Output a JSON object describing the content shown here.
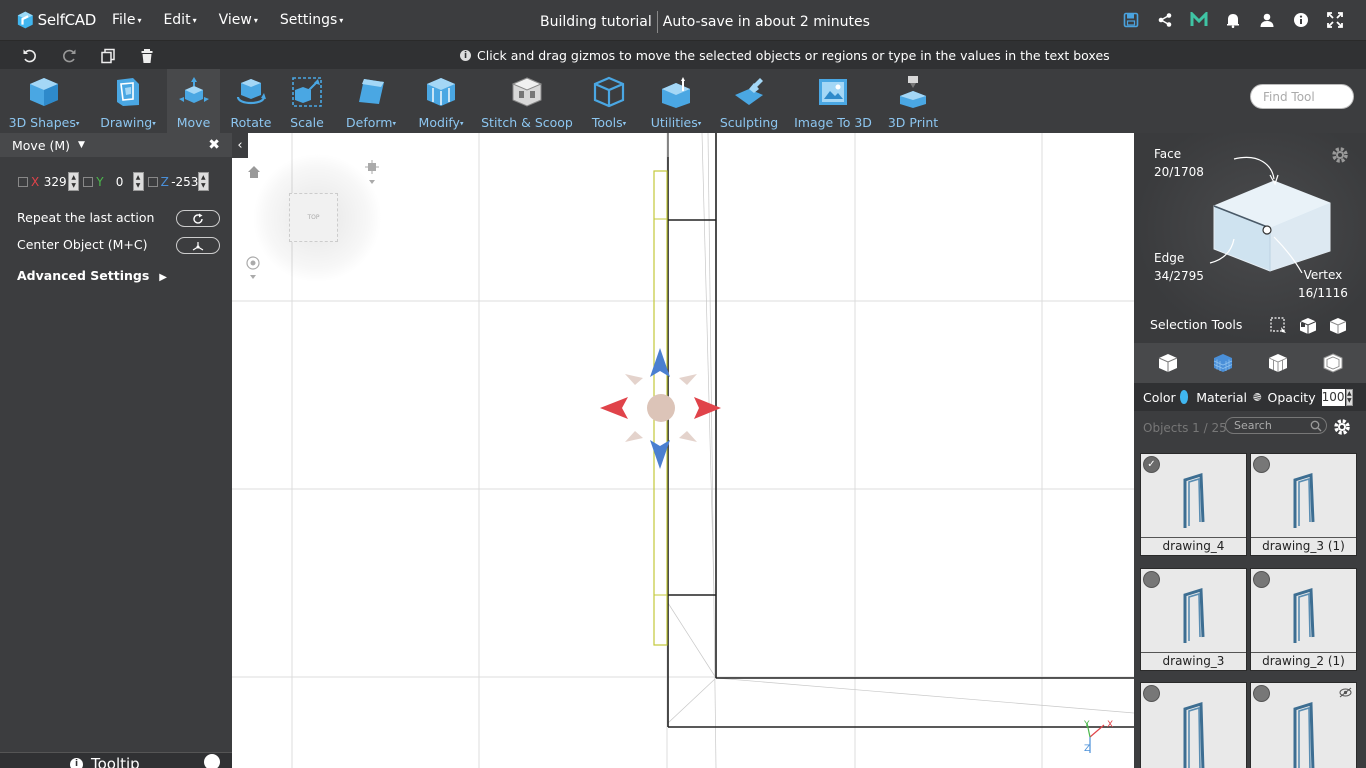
{
  "app": {
    "name": "SelfCAD"
  },
  "menu": [
    {
      "label": "File"
    },
    {
      "label": "Edit"
    },
    {
      "label": "View"
    },
    {
      "label": "Settings"
    }
  ],
  "project": {
    "title": "Building tutorial",
    "autosave": "Auto-save in about 2 minutes"
  },
  "topbar_icons": [
    "save-icon",
    "share-icon",
    "m-icon",
    "bell-icon",
    "user-icon",
    "info-icon",
    "fullscreen-icon"
  ],
  "secondbar": {
    "icons": [
      "undo-icon",
      "redo-icon",
      "copy-icon",
      "delete-icon"
    ],
    "hint": "Click and drag gizmos to move the selected objects or regions or type in the values in the text boxes"
  },
  "toolbar": {
    "tools": [
      {
        "label": "3D Shapes",
        "dropdown": true
      },
      {
        "label": "Drawing",
        "dropdown": true
      },
      {
        "label": "Move",
        "dropdown": false,
        "active": true
      },
      {
        "label": "Rotate",
        "dropdown": false
      },
      {
        "label": "Scale",
        "dropdown": false
      },
      {
        "label": "Deform",
        "dropdown": true
      },
      {
        "label": "Modify",
        "dropdown": true
      },
      {
        "label": "Stitch & Scoop",
        "dropdown": false
      },
      {
        "label": "Tools",
        "dropdown": true
      },
      {
        "label": "Utilities",
        "dropdown": true
      },
      {
        "label": "Sculpting",
        "dropdown": false
      },
      {
        "label": "Image To 3D",
        "dropdown": false
      },
      {
        "label": "3D Print",
        "dropdown": false
      }
    ],
    "find_placeholder": "Find Tool"
  },
  "left_panel": {
    "title": "Move (M)",
    "x_label": "X",
    "x_value": "329",
    "y_label": "Y",
    "y_value": "0",
    "z_label": "Z",
    "z_value": "-253",
    "repeat_label": "Repeat the last action",
    "center_label": "Center Object (M+C)",
    "advanced_label": "Advanced Settings",
    "tooltip_label": "Tooltip"
  },
  "viewport": {
    "viewcube_label": "TOP"
  },
  "right_panel": {
    "face_label": "Face",
    "face_value": "20/1708",
    "edge_label": "Edge",
    "edge_value": "34/2795",
    "vertex_label": "Vertex",
    "vertex_value": "16/1116",
    "selection_tools_label": "Selection Tools",
    "color_label": "Color",
    "color_value": "#40b6ef",
    "material_label": "Material",
    "opacity_label": "Opacity",
    "opacity_value": "100",
    "objects_label": "Objects 1 / 25",
    "search_placeholder": "Search",
    "objects": [
      {
        "name": "drawing_4",
        "selected": true
      },
      {
        "name": "drawing_3 (1)",
        "selected": false
      },
      {
        "name": "drawing_3",
        "selected": false
      },
      {
        "name": "drawing_2 (1)",
        "selected": false
      },
      {
        "name": "",
        "selected": false
      },
      {
        "name": "",
        "selected": false,
        "hidden": true
      }
    ]
  },
  "colors": {
    "accent": "#8dc6f0",
    "x_axis": "#e0434a",
    "y_axis": "#4bb84b",
    "z_axis": "#4a8fd8",
    "panel": "#3c3d3f"
  }
}
